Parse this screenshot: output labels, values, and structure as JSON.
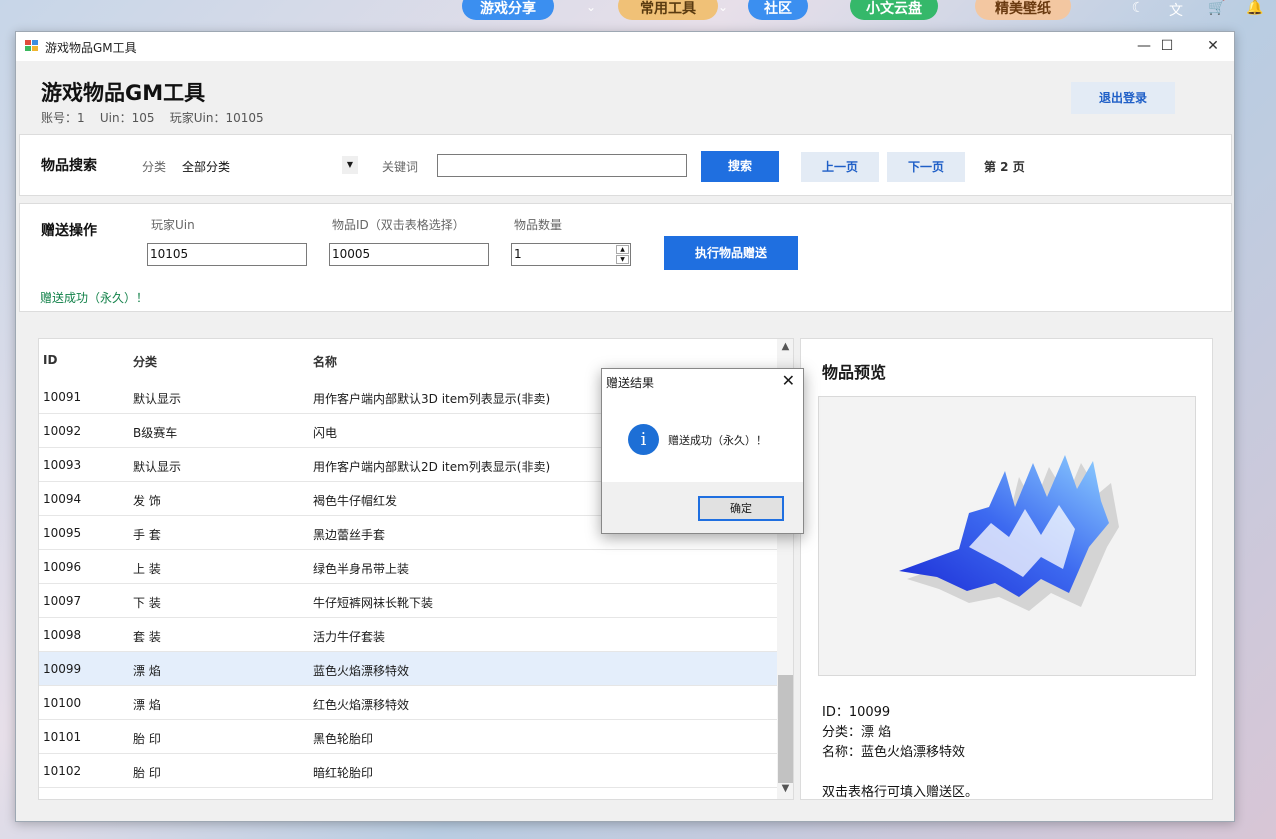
{
  "desktop": {
    "pills": [
      "游戏分享",
      "常用工具",
      "社区",
      "小文云盘",
      "精美壁纸"
    ]
  },
  "window": {
    "title": "游戏物品GM工具"
  },
  "header": {
    "title": "游戏物品GM工具",
    "subtitle": "账号：1    Uin：105    玩家Uin：10105",
    "logout_label": "退出登录"
  },
  "search": {
    "section_title": "物品搜索",
    "category_label": "分类",
    "category_value": "全部分类",
    "keyword_label": "关键词",
    "keyword_value": "",
    "search_button": "搜索",
    "prev_button": "上一页",
    "next_button": "下一页",
    "page_info": "第 2 页"
  },
  "gift": {
    "section_title": "赠送操作",
    "player_uin_label": "玩家Uin",
    "player_uin_value": "10105",
    "item_id_label": "物品ID（双击表格选择）",
    "item_id_value": "10005",
    "quantity_label": "物品数量",
    "quantity_value": "1",
    "execute_button": "执行物品赠送",
    "status_text": "赠送成功（永久）！"
  },
  "table": {
    "columns": [
      "ID",
      "分类",
      "名称"
    ],
    "rows": [
      [
        "10091",
        "默认显示",
        "用作客户端内部默认3D item列表显示(非卖)"
      ],
      [
        "10092",
        "B级赛车",
        "闪电"
      ],
      [
        "10093",
        "默认显示",
        "用作客户端内部默认2D item列表显示(非卖)"
      ],
      [
        "10094",
        "发 饰",
        "褐色牛仔帽红发"
      ],
      [
        "10095",
        "手 套",
        "黑边蕾丝手套"
      ],
      [
        "10096",
        "上 装",
        "绿色半身吊带上装"
      ],
      [
        "10097",
        "下 装",
        "牛仔短裤网袜长靴下装"
      ],
      [
        "10098",
        "套 装",
        "活力牛仔套装"
      ],
      [
        "10099",
        "漂 焰",
        "蓝色火焰漂移特效"
      ],
      [
        "10100",
        "漂 焰",
        "红色火焰漂移特效"
      ],
      [
        "10101",
        "胎 印",
        "黑色轮胎印"
      ],
      [
        "10102",
        "胎 印",
        "暗红轮胎印"
      ]
    ],
    "selected_index": 8
  },
  "preview": {
    "title": "物品预览",
    "id_line": "ID：10099",
    "category_line": "分类：漂 焰",
    "name_line": "名称：蓝色火焰漂移特效",
    "hint": "双击表格行可填入赠送区。"
  },
  "dialog": {
    "title": "赠送结果",
    "message": "赠送成功（永久）！",
    "ok_button": "确定",
    "close_glyph": "✕",
    "icon_glyph": "i"
  },
  "icons": [
    "moon-icon",
    "translate-icon",
    "cart-icon",
    "bell-icon",
    "info-icon"
  ]
}
